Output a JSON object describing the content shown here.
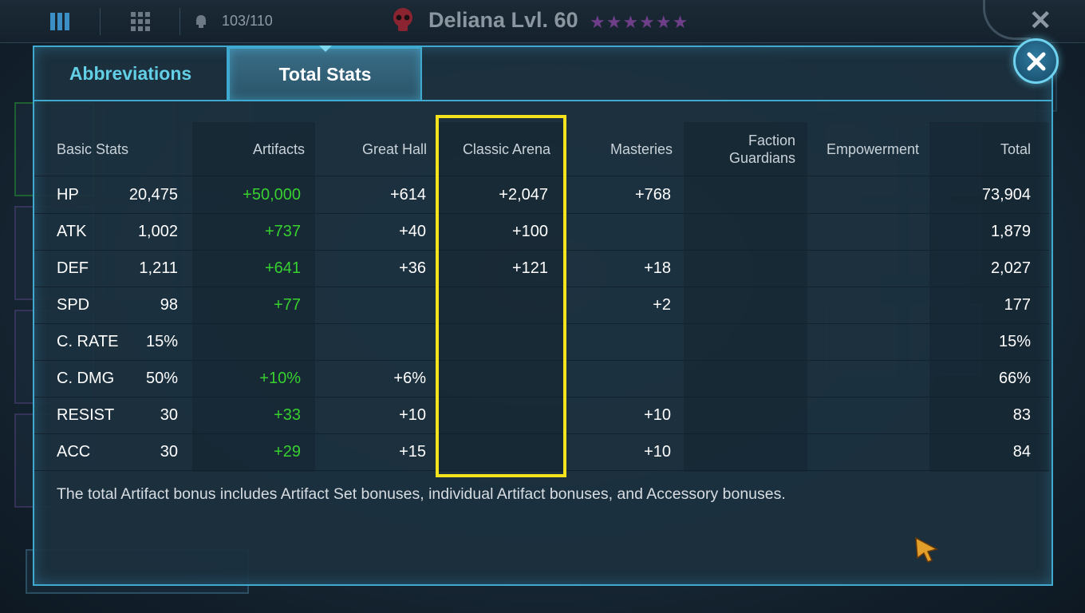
{
  "topbar": {
    "inventory": "103/110",
    "hero_name": "Deliana Lvl. 60",
    "stars": "★★★★★★"
  },
  "dialog": {
    "tabs": [
      {
        "label": "Abbreviations"
      },
      {
        "label": "Total Stats"
      }
    ],
    "headers": {
      "basic": "Basic Stats",
      "artifacts": "Artifacts",
      "great_hall": "Great Hall",
      "classic_arena": "Classic Arena",
      "masteries": "Masteries",
      "faction_1": "Faction",
      "faction_2": "Guardians",
      "empowerment": "Empowerment",
      "total": "Total"
    },
    "rows": [
      {
        "stat": "HP",
        "base": "20,475",
        "artifacts": "+50,000",
        "great_hall": "+614",
        "arena": "+2,047",
        "masteries": "+768",
        "faction": "",
        "empowerment": "",
        "total": "73,904"
      },
      {
        "stat": "ATK",
        "base": "1,002",
        "artifacts": "+737",
        "great_hall": "+40",
        "arena": "+100",
        "masteries": "",
        "faction": "",
        "empowerment": "",
        "total": "1,879"
      },
      {
        "stat": "DEF",
        "base": "1,211",
        "artifacts": "+641",
        "great_hall": "+36",
        "arena": "+121",
        "masteries": "+18",
        "faction": "",
        "empowerment": "",
        "total": "2,027"
      },
      {
        "stat": "SPD",
        "base": "98",
        "artifacts": "+77",
        "great_hall": "",
        "arena": "",
        "masteries": "+2",
        "faction": "",
        "empowerment": "",
        "total": "177"
      },
      {
        "stat": "C. RATE",
        "base": "15%",
        "artifacts": "",
        "great_hall": "",
        "arena": "",
        "masteries": "",
        "faction": "",
        "empowerment": "",
        "total": "15%"
      },
      {
        "stat": "C. DMG",
        "base": "50%",
        "artifacts": "+10%",
        "great_hall": "+6%",
        "arena": "",
        "masteries": "",
        "faction": "",
        "empowerment": "",
        "total": "66%"
      },
      {
        "stat": "RESIST",
        "base": "30",
        "artifacts": "+33",
        "great_hall": "+10",
        "arena": "",
        "masteries": "+10",
        "faction": "",
        "empowerment": "",
        "total": "83"
      },
      {
        "stat": "ACC",
        "base": "30",
        "artifacts": "+29",
        "great_hall": "+15",
        "arena": "",
        "masteries": "+10",
        "faction": "",
        "empowerment": "",
        "total": "84"
      }
    ],
    "footnote": "The total Artifact bonus includes Artifact Set bonuses, individual Artifact bonuses, and Accessory bonuses."
  },
  "colors": {
    "accent": "#3fa9cf",
    "bonus_green": "#37d02f",
    "highlight": "#f4e21c"
  }
}
